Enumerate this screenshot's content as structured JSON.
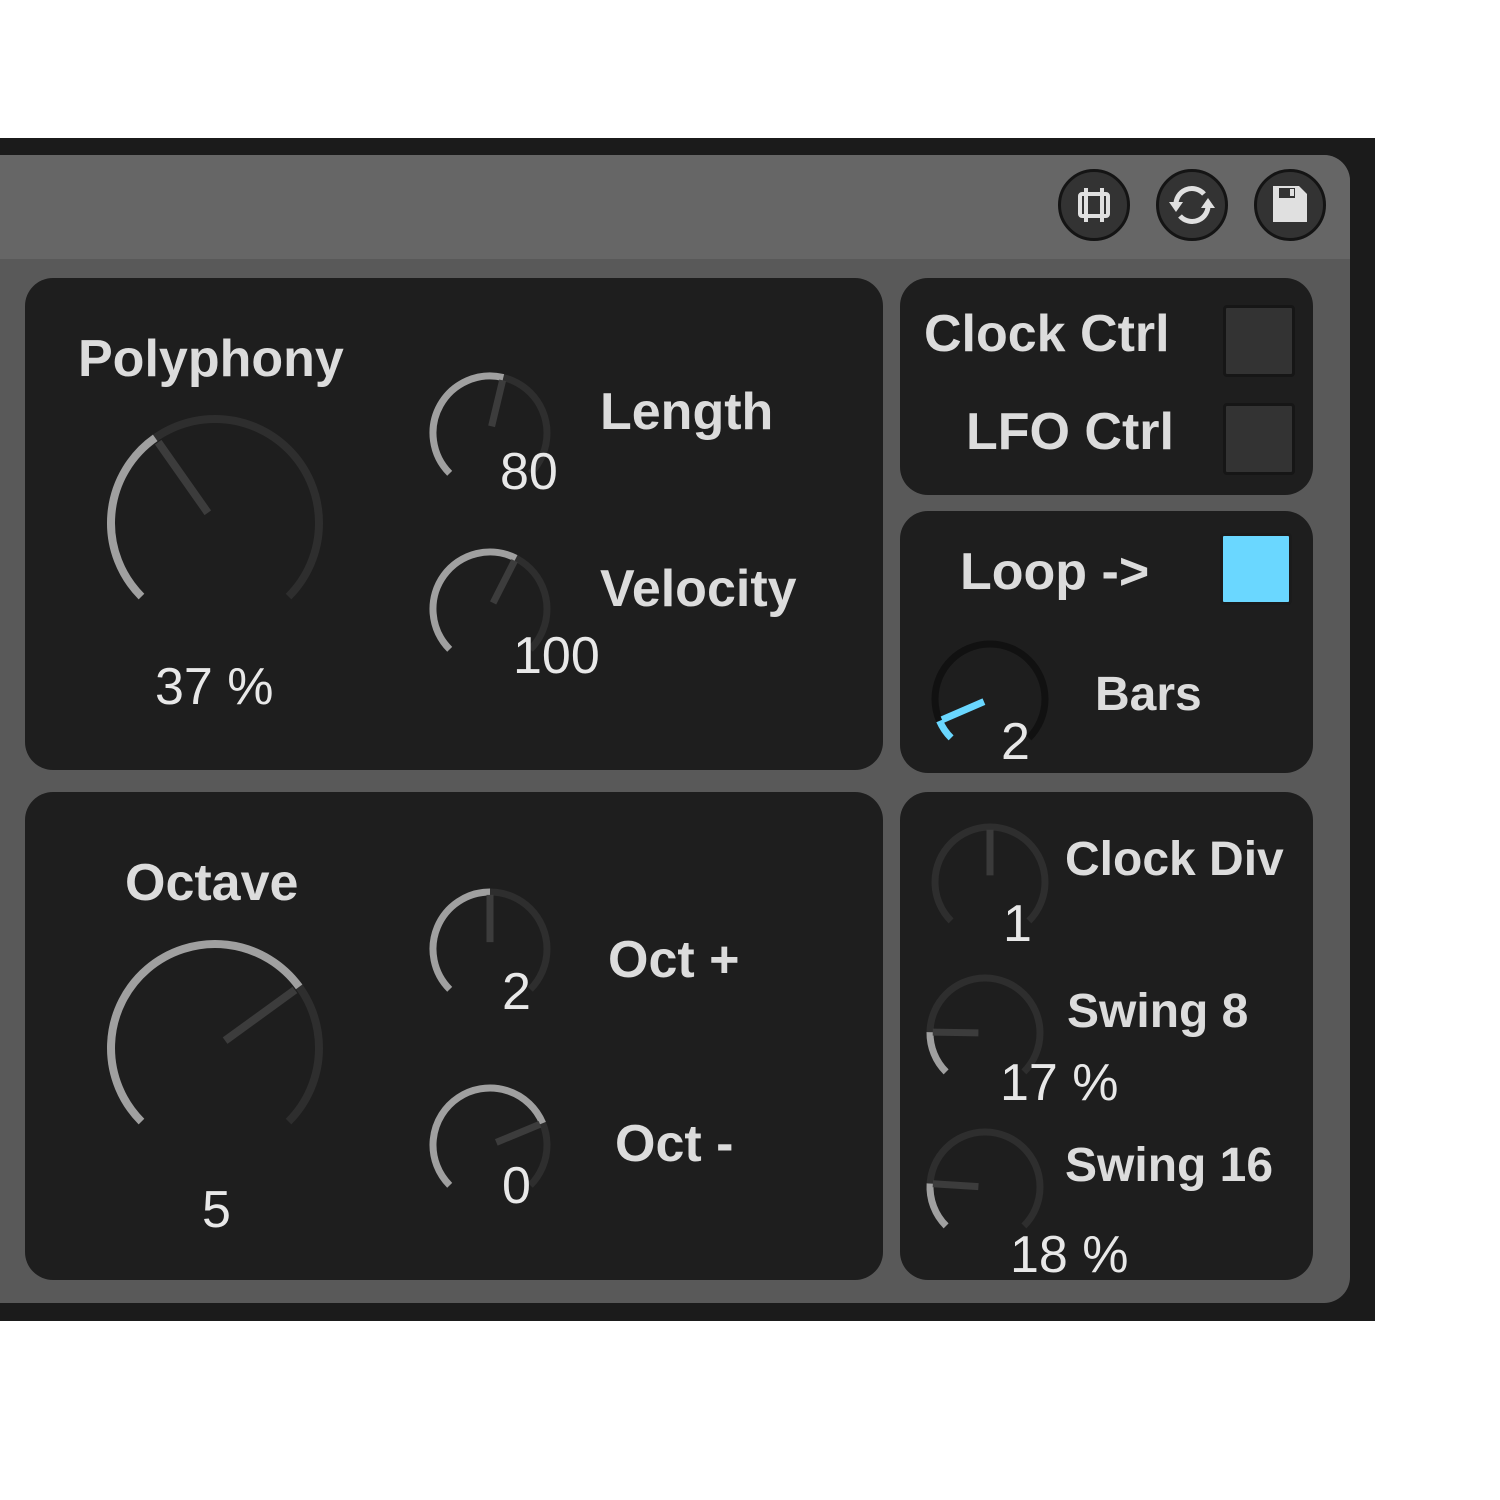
{
  "toolbar": {
    "buttons": [
      {
        "icon": "resize-icon"
      },
      {
        "icon": "refresh-icon"
      },
      {
        "icon": "save-icon"
      }
    ]
  },
  "main": {
    "polyphony": {
      "label": "Polyphony",
      "value": "37 %",
      "level": 0.37
    },
    "length": {
      "label": "Length",
      "value": "80",
      "level": 0.55
    },
    "velocity": {
      "label": "Velocity",
      "value": "100",
      "level": 0.6
    },
    "octave": {
      "label": "Octave",
      "value": "5",
      "level": 0.7
    },
    "oct_plus": {
      "label": "Oct +",
      "value": "2",
      "level": 0.5
    },
    "oct_minus": {
      "label": "Oct -",
      "value": "0",
      "level": 0.75
    }
  },
  "side": {
    "clock_ctrl": {
      "label": "Clock Ctrl",
      "on": false
    },
    "lfo_ctrl": {
      "label": "LFO Ctrl",
      "on": false
    },
    "loop": {
      "label": "Loop ->",
      "on": true
    },
    "bars": {
      "label": "Bars",
      "value": "2",
      "level": 0.08
    },
    "clock_div": {
      "label": "Clock Div",
      "value": "1",
      "level": 0.5
    },
    "swing8": {
      "label": "Swing 8",
      "value": "17 %",
      "level": 0.17
    },
    "swing16": {
      "label": "Swing 16",
      "value": "18 %",
      "level": 0.18
    }
  },
  "colors": {
    "accent": "#6ad7ff",
    "panel": "#1e1e1e",
    "device": "#595959",
    "titlebar": "#666666",
    "arc_active": "#a0a0a0",
    "arc_inactive": "#2e2e2e",
    "text": "#dcdcdc"
  }
}
